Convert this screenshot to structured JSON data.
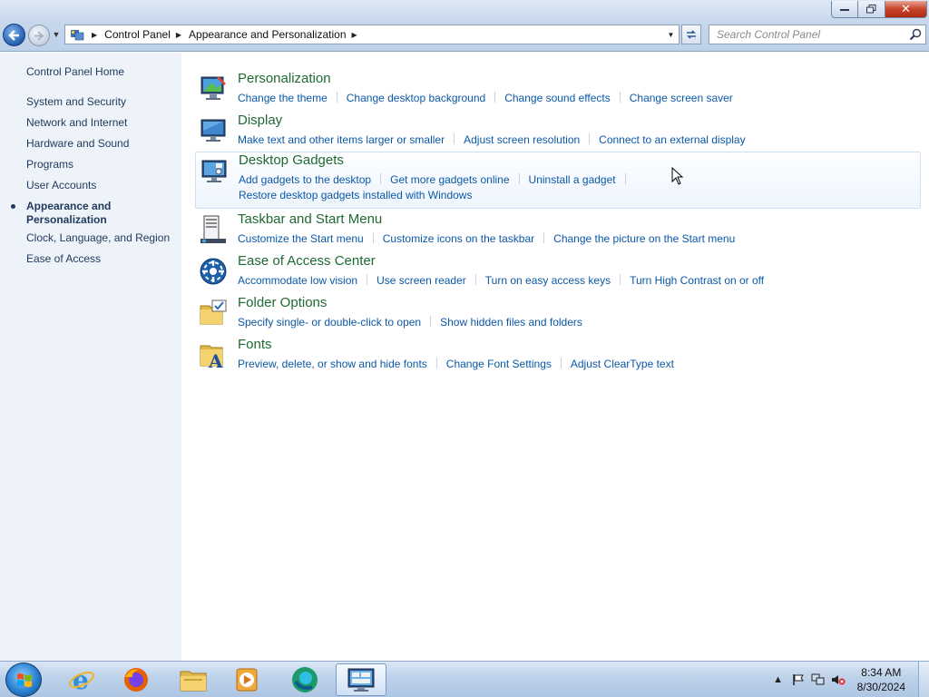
{
  "window": {
    "min_icon": "minimize-icon",
    "max_icon": "restore-icon",
    "close_glyph": "✕"
  },
  "nav": {
    "back_icon": "back-arrow-icon",
    "forward_icon": "forward-arrow-icon",
    "breadcrumbs": [
      "Control Panel",
      "Appearance and Personalization"
    ],
    "search_placeholder": "Search Control Panel"
  },
  "sidebar": {
    "home": "Control Panel Home",
    "items": [
      "System and Security",
      "Network and Internet",
      "Hardware and Sound",
      "Programs",
      "User Accounts",
      "Appearance and\nPersonalization",
      "Clock, Language, and Region",
      "Ease of Access"
    ],
    "active_index": 5
  },
  "categories": [
    {
      "title": "Personalization",
      "icon": "personalization-icon",
      "links": [
        "Change the theme",
        "Change desktop background",
        "Change sound effects",
        "Change screen saver"
      ]
    },
    {
      "title": "Display",
      "icon": "display-icon",
      "links": [
        "Make text and other items larger or smaller",
        "Adjust screen resolution",
        "Connect to an external display"
      ]
    },
    {
      "title": "Desktop Gadgets",
      "icon": "desktop-gadgets-icon",
      "links": [
        "Add gadgets to the desktop",
        "Get more gadgets online",
        "Uninstall a gadget",
        "Restore desktop gadgets installed with Windows"
      ]
    },
    {
      "title": "Taskbar and Start Menu",
      "icon": "taskbar-icon",
      "links": [
        "Customize the Start menu",
        "Customize icons on the taskbar",
        "Change the picture on the Start menu"
      ]
    },
    {
      "title": "Ease of Access Center",
      "icon": "ease-of-access-icon",
      "links": [
        "Accommodate low vision",
        "Use screen reader",
        "Turn on easy access keys",
        "Turn High Contrast on or off"
      ]
    },
    {
      "title": "Folder Options",
      "icon": "folder-options-icon",
      "links": [
        "Specify single- or double-click to open",
        "Show hidden files and folders"
      ]
    },
    {
      "title": "Fonts",
      "icon": "fonts-icon",
      "links": [
        "Preview, delete, or show and hide fonts",
        "Change Font Settings",
        "Adjust ClearType text"
      ]
    }
  ],
  "taskbar": {
    "apps": [
      "internet-explorer-icon",
      "firefox-icon",
      "file-explorer-icon",
      "media-player-icon",
      "edge-icon",
      "control-panel-icon"
    ],
    "time": "8:34 AM",
    "date": "8/30/2024"
  },
  "colors": {
    "link": "#0b58a8",
    "category_title": "#1e6a32",
    "sidebar_bg": "#eef3fa"
  }
}
